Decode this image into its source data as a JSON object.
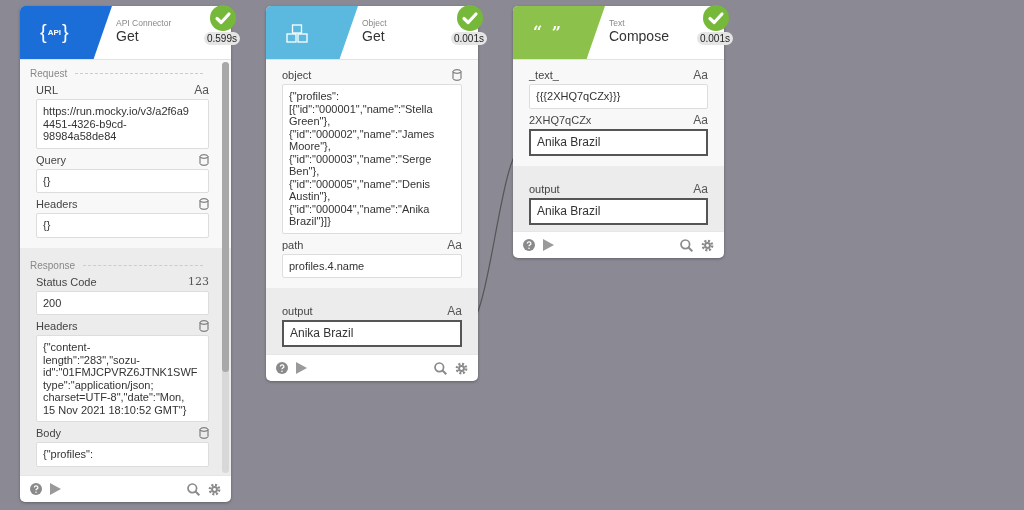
{
  "nodes": [
    {
      "logo": {
        "kind": "api",
        "parts": [
          "{",
          "API",
          "}"
        ]
      },
      "color": "#1b6ed8",
      "category": "API Connector",
      "title": "Get",
      "time": "0.599s",
      "scrollable": true,
      "sections": [
        {
          "title": "Request",
          "shaded": false,
          "fields": [
            {
              "label": "URL",
              "kind": "text",
              "type_label": "Aa",
              "value": "https://run.mocky.io/v3/a2f6a9\n4451-4326-b9cd-\n98984a58de84",
              "outlined": false
            },
            {
              "label": "Query",
              "kind": "object",
              "value": "{}",
              "outlined": false
            },
            {
              "label": "Headers",
              "kind": "object",
              "value": "{}",
              "outlined": false
            }
          ]
        },
        {
          "title": "Response",
          "shaded": true,
          "fields": [
            {
              "label": "Status Code",
              "kind": "number",
              "type_label": "123",
              "value": "200",
              "outlined": false
            },
            {
              "label": "Headers",
              "kind": "object",
              "value": "{\"content-\nlength\":\"283\",\"sozu-\nid\":\"01FMJCPVRZ6JTNK1SWF\ntype\":\"application/json;\ncharset=UTF-8\",\"date\":\"Mon,\n15 Nov 2021 18:10:52 GMT\"}",
              "outlined": false
            },
            {
              "label": "Body",
              "kind": "object",
              "value": "{\"profiles\":",
              "outlined": false
            }
          ]
        }
      ]
    },
    {
      "logo": {
        "kind": "object"
      },
      "color": "#5bb9df",
      "category": "Object",
      "title": "Get",
      "time": "0.001s",
      "scrollable": false,
      "sections": [
        {
          "shaded": false,
          "fields": [
            {
              "label": "object",
              "kind": "object",
              "value": "{\"profiles\":\n[{\"id\":\"000001\",\"name\":\"Stella\nGreen\"},\n{\"id\":\"000002\",\"name\":\"James\nMoore\"},\n{\"id\":\"000003\",\"name\":\"Serge\nBen\"},\n{\"id\":\"000005\",\"name\":\"Denis\nAustin\"},\n{\"id\":\"000004\",\"name\":\"Anika\nBrazil\"}]}",
              "outlined": false
            },
            {
              "label": "path",
              "kind": "text",
              "type_label": "Aa",
              "value": "profiles.4.name",
              "outlined": false
            }
          ]
        },
        {
          "shaded": true,
          "fields": [
            {
              "label": "output",
              "kind": "text",
              "type_label": "Aa",
              "value": "Anika Brazil",
              "outlined": true
            }
          ]
        }
      ]
    },
    {
      "logo": {
        "kind": "text",
        "parts": [
          "“ ”"
        ]
      },
      "color": "#8cc24b",
      "category": "Text",
      "title": "Compose",
      "time": "0.001s",
      "scrollable": false,
      "sections": [
        {
          "shaded": false,
          "fields": [
            {
              "label": "_text_",
              "kind": "text",
              "type_label": "Aa",
              "value": "{{{2XHQ7qCZx}}}",
              "outlined": false
            },
            {
              "label": "2XHQ7qCZx",
              "kind": "text",
              "type_label": "Aa",
              "value": "Anika Brazil",
              "outlined": true
            }
          ]
        },
        {
          "shaded": true,
          "fields": [
            {
              "label": "output",
              "kind": "text",
              "type_label": "Aa",
              "value": "Anika Brazil",
              "outlined": true
            }
          ]
        }
      ]
    }
  ]
}
